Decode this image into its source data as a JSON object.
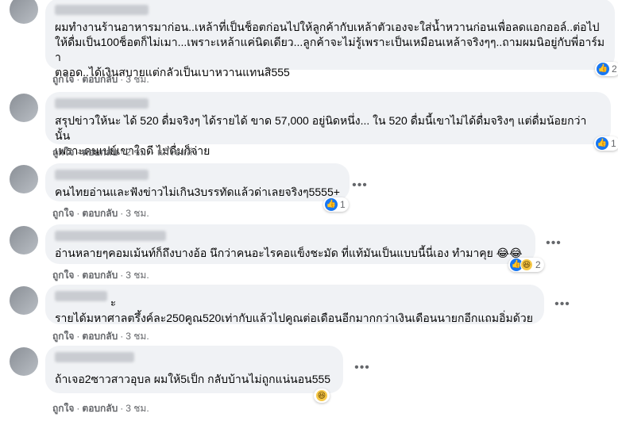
{
  "comments": [
    {
      "text": "ผมทำงานร้านอาหารมาก่อน..เหล้าที่เป็นช็อตก่อนไปให้ลูกค้ากับเหล้าตัวเองจะใส่น้ำหวานก่อนเพื่อลดแอกออล์..ต่อไป\nให้ดื่มเป็น100ช็อตก็ไม่เมา...เพราะเหล้าแค่นิดเดียว...ลูกค้าจะไม่รู้เพราะเป็นเหมือนเหล้าจริงๆๆ..ถามผมนิอยู่กับพี่อาร์มา\nตลอด..ได้เงินสบายแต่กลัวเป็นเบาหวานแทนสิ555",
      "like": "ถูกใจ",
      "reply": "ตอบกลับ",
      "time": "3 ชม.",
      "reaction_count": "2"
    },
    {
      "text": "สรุปข่าวให้นะ ได้ 520 ดื่มจริงๆ ได้รายได้ ขาด 57,000 อยู่นิดหนึ่ง... ใน 520 ดื่มนี้เขาไม่ได้ดื่มจริงๆ แต่ดื่มน้อยกว่านั้น\nเพราะคนเปย์เขาใจดี ไม่ดื่มก็จ่าย",
      "like": "ถูกใจ",
      "reply": "ตอบกลับ",
      "time": "2 ชม.",
      "edited": "แก้ไขแล้ว",
      "reaction_count": "1"
    },
    {
      "text": "คนไทยอ่านและฟังข่าวไม่เกิน3บรรทัดแล้วด่าเลยจริงๆ5555+",
      "like": "ถูกใจ",
      "reply": "ตอบกลับ",
      "time": "3 ชม.",
      "reaction_count": "1"
    },
    {
      "text": "อ่านหลายๆคอมเม้นท์ก็ถึงบางอ้อ นึกว่าคนอะไรคอแข็งชะมัด ที่แท้มันเป็นแบบนี้นี่เอง ทำมาคุย 😂😂",
      "like": "ถูกใจ",
      "reply": "ตอบกลับ",
      "time": "3 ชม.",
      "reaction_count": "2"
    },
    {
      "author_suffix": "ะ",
      "text": "รายได้มหาศาลตรึ้งค์ละ250คูณ520เท่ากับแล้วไปคูณต่อเดือนอีกมากกว่าเงินเดือนนายกอีกแถมอิ่มด้วย",
      "like": "ถูกใจ",
      "reply": "ตอบกลับ",
      "time": "3 ชม."
    },
    {
      "text": "ถ้าเจอ2ซาวสาวอุบล ผมให้5เป็ก กลับบ้านไม่ถูกแน่นอน555",
      "like": "ถูกใจ",
      "reply": "ตอบกลับ",
      "time": "3 ชม."
    }
  ],
  "icons": {
    "like": "👍",
    "haha": "😆",
    "more": "•••"
  },
  "colors": {
    "bubble": "#f0f2f5",
    "like_blue": "#1877f2",
    "meta_gray": "#65676b"
  }
}
